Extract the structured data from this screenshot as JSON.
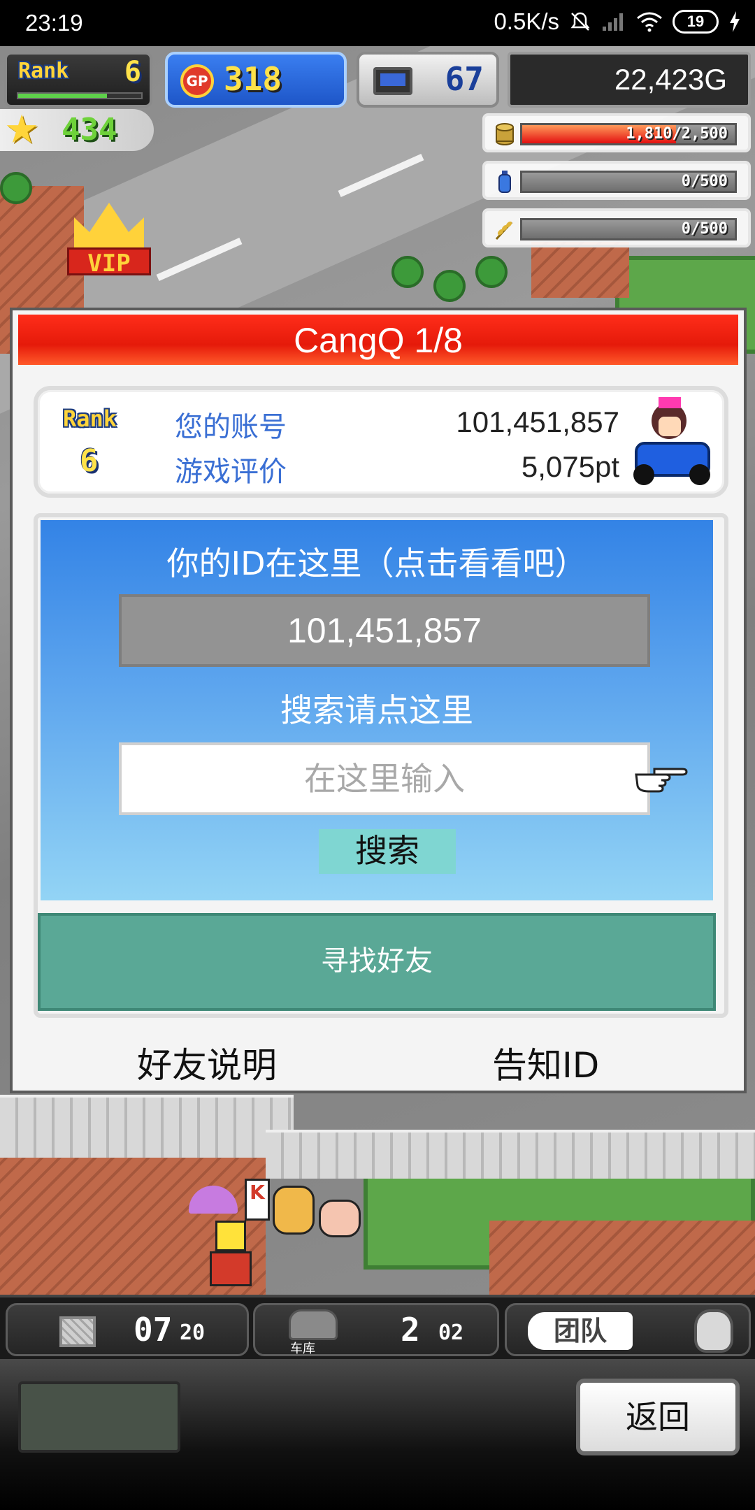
{
  "status_bar": {
    "time": "23:19",
    "net_speed": "0.5K/s",
    "battery": "19"
  },
  "hud": {
    "rank_label": "Rank",
    "rank_value": "6",
    "gp_label": "GP",
    "gp_value": "318",
    "pc_value": "67",
    "money": "22,423G",
    "stars": "434",
    "vip_label": "VIP",
    "resources": [
      {
        "icon": "coin-stack-icon",
        "text": "1,810/2,500",
        "fill": 0.724
      },
      {
        "icon": "fuel-bottle-icon",
        "text": "0/500",
        "fill": 0
      },
      {
        "icon": "wheat-icon",
        "text": "0/500",
        "fill": 0
      }
    ]
  },
  "dialog": {
    "title": "CangQ 1/8",
    "info": {
      "rank_label": "Rank",
      "rank_value": "6",
      "account_label": "您的账号",
      "account_value": "101,451,857",
      "rating_label": "游戏评价",
      "rating_value": "5,075pt"
    },
    "id_title": "你的ID在这里（点击看看吧）",
    "id_value": "101,451,857",
    "search_title": "搜索请点这里",
    "search_placeholder": "在这里输入",
    "search_button": "搜索",
    "find_friends_button": "寻找好友",
    "friend_help_link": "好友说明",
    "share_id_link": "告知ID"
  },
  "bottom_hud": {
    "storage_count": "07",
    "storage_total": "20",
    "garage_label": "车库",
    "garage_count": "2",
    "garage_total": "02",
    "team_button": "团队"
  },
  "bottom_area": {
    "back_button": "返回"
  },
  "colors": {
    "title_red": "#e51a0a",
    "panel_blue": "#3383e6",
    "find_green": "#5aa896",
    "search_btn": "#7fd6d2",
    "label_blue": "#3a6fd4"
  }
}
